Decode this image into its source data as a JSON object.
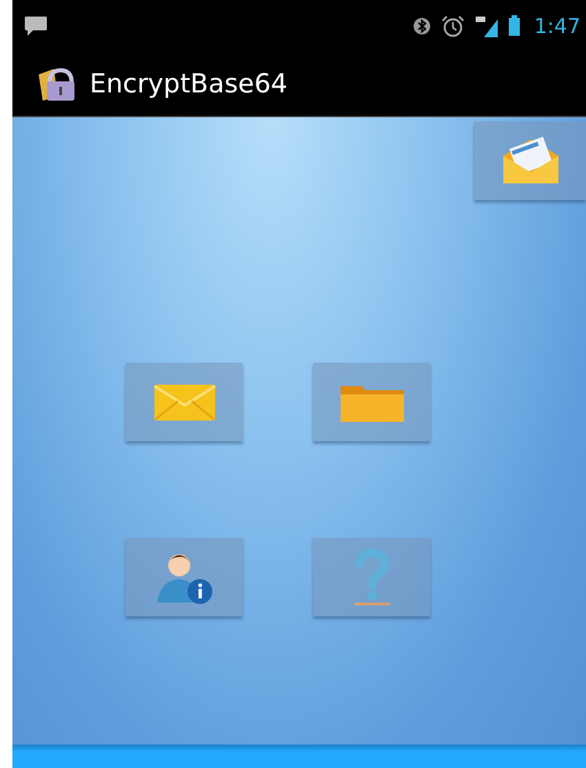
{
  "status_bar": {
    "time": "1:47"
  },
  "app_bar": {
    "title": "EncryptBase64"
  },
  "corner_button": {
    "kind": "compose"
  },
  "grid_buttons": [
    {
      "kind": "mail"
    },
    {
      "kind": "folder"
    },
    {
      "kind": "contact"
    },
    {
      "kind": "help"
    }
  ]
}
